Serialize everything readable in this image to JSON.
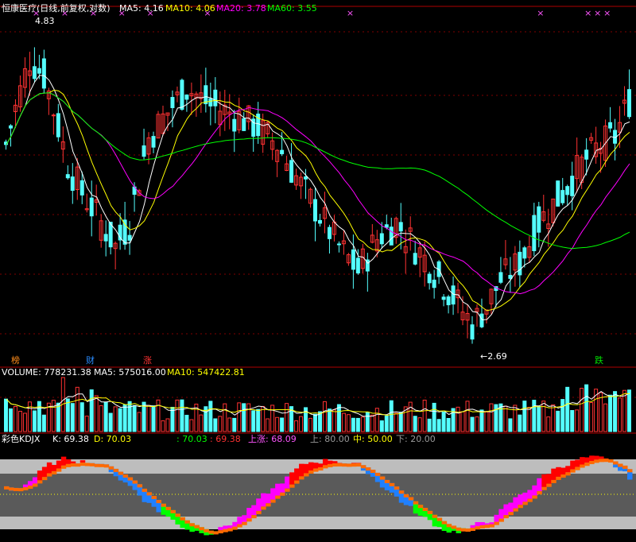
{
  "header": {
    "stock_title": "恒康医疗(日线,前复权,对数)",
    "ma5": "MA5: 4.16",
    "ma10": "MA10: 4.06",
    "ma20": "MA20: 3.78",
    "ma60": "MA60: 3.55"
  },
  "price_annotations": {
    "high": "4.83",
    "low": "←2.69"
  },
  "signals": {
    "bang": "榜",
    "cai": "财",
    "zhang": "涨",
    "die": "跌"
  },
  "volume_header": {
    "volume": "VOLUME: 778231.38",
    "ma5": "MA5: 575016.00",
    "ma10": "MA10: 547422.81"
  },
  "kdj_header": {
    "name": "彩色KDJX",
    "k": "K: 69.38",
    "d": "D: 70.03",
    "v1": ": 70.03",
    "v2": ": 69.38",
    "up": "上涨: 68.09",
    "upper": "上: 80.00",
    "middle": "中: 50.00",
    "lower": "下: 20.00"
  },
  "colors": {
    "up": "#ff3232",
    "down": "#54ffff",
    "ma5": "#ffffff",
    "ma10": "#ffff00",
    "ma20": "#ff00ff",
    "ma60": "#00ff00",
    "grid": "#800000"
  },
  "chart_data": [
    {
      "type": "candlestick",
      "title": "恒康医疗(日线,前复权,对数)",
      "ylim": [
        2.6,
        5.0
      ],
      "y_scale": "log",
      "series": [
        {
          "name": "MA5",
          "values": [
            4.16
          ]
        },
        {
          "name": "MA10",
          "values": [
            4.06
          ]
        },
        {
          "name": "MA20",
          "values": [
            3.78
          ]
        },
        {
          "name": "MA60",
          "values": [
            3.55
          ]
        }
      ],
      "annotations": [
        {
          "label": "4.83",
          "value": 4.83
        },
        {
          "label": "2.69",
          "value": 2.69
        }
      ],
      "grid": true
    },
    {
      "type": "bar",
      "title": "VOLUME",
      "series": [
        {
          "name": "VOLUME",
          "values": [
            778231.38
          ]
        },
        {
          "name": "MA5",
          "values": [
            575016.0
          ]
        },
        {
          "name": "MA10",
          "values": [
            547422.81
          ]
        }
      ]
    },
    {
      "type": "area",
      "title": "彩色KDJX",
      "ylim": [
        0,
        100
      ],
      "series": [
        {
          "name": "K",
          "values": [
            69.38
          ]
        },
        {
          "name": "D",
          "values": [
            70.03
          ]
        },
        {
          "name": "上涨",
          "values": [
            68.09
          ]
        }
      ],
      "reference_lines": [
        {
          "name": "上",
          "value": 80.0
        },
        {
          "name": "中",
          "value": 50.0
        },
        {
          "name": "下",
          "value": 20.0
        }
      ]
    }
  ]
}
